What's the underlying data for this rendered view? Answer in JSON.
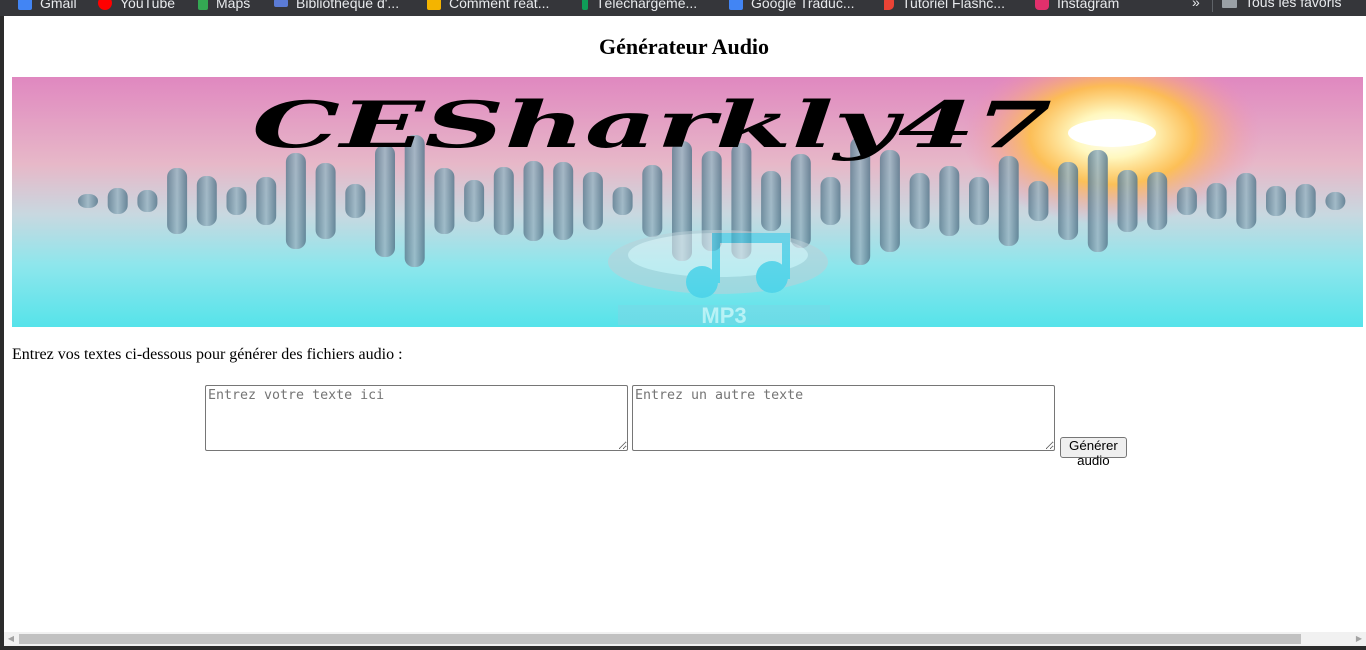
{
  "bookmarks": [
    {
      "label": "Gmail",
      "icon": "gmail-icon",
      "color": "#4285f4"
    },
    {
      "label": "YouTube",
      "icon": "youtube-icon",
      "color": "#ff0000"
    },
    {
      "label": "Maps",
      "icon": "maps-icon",
      "color": "#34a853"
    },
    {
      "label": "Bibliothèque d'...",
      "icon": "library-icon",
      "color": "#5b7bd5"
    },
    {
      "label": "Comment réat...",
      "icon": "notes-icon",
      "color": "#f4b400"
    },
    {
      "label": "Téléchargeme...",
      "icon": "download-icon",
      "color": "#0f9d58"
    },
    {
      "label": "Google Traduc...",
      "icon": "translate-icon",
      "color": "#4285f4"
    },
    {
      "label": "Tutoriel Flashc...",
      "icon": "pin-icon",
      "color": "#ea4335"
    },
    {
      "label": "Instagram",
      "icon": "instagram-icon",
      "color": "#e1306c"
    }
  ],
  "bookmarks_more": "»",
  "bookmarks_folder": "Tous les favoris",
  "page": {
    "title": "Générateur Audio",
    "banner": {
      "signature": "CESharkly47",
      "badge": "MP3"
    },
    "instructions": "Entrez vos textes ci-dessous pour générer des fichiers audio :",
    "input1_placeholder": "Entrez votre texte ici",
    "input2_placeholder": "Entrez un autre texte",
    "generate_label": "Générer audio"
  },
  "scrollbar": {
    "left_arrow": "◀",
    "right_arrow": "▶"
  }
}
